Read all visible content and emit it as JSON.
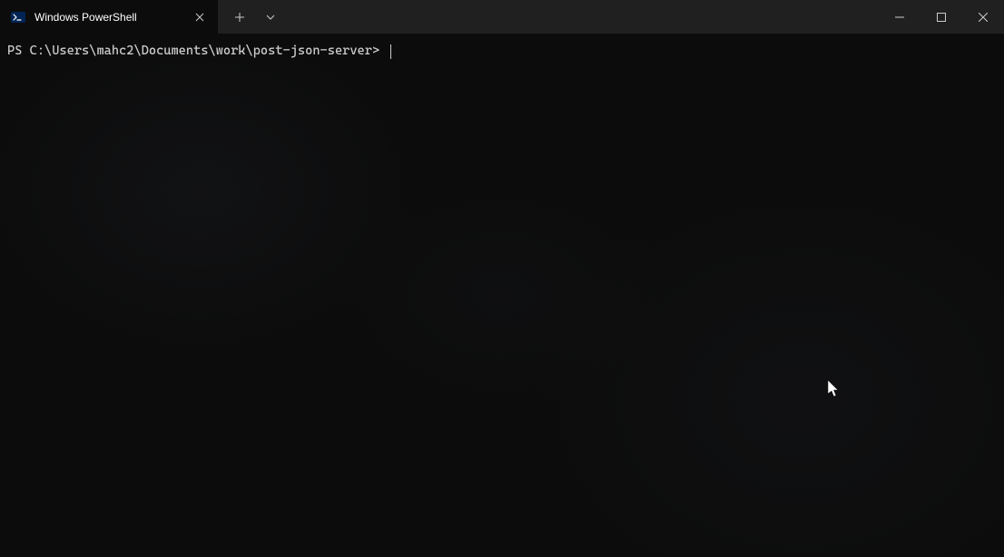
{
  "tab": {
    "title": "Windows PowerShell",
    "icon_name": "powershell-icon"
  },
  "terminal": {
    "prompt": "PS C:\\Users\\mahc2\\Documents\\work\\post-json-server> "
  }
}
